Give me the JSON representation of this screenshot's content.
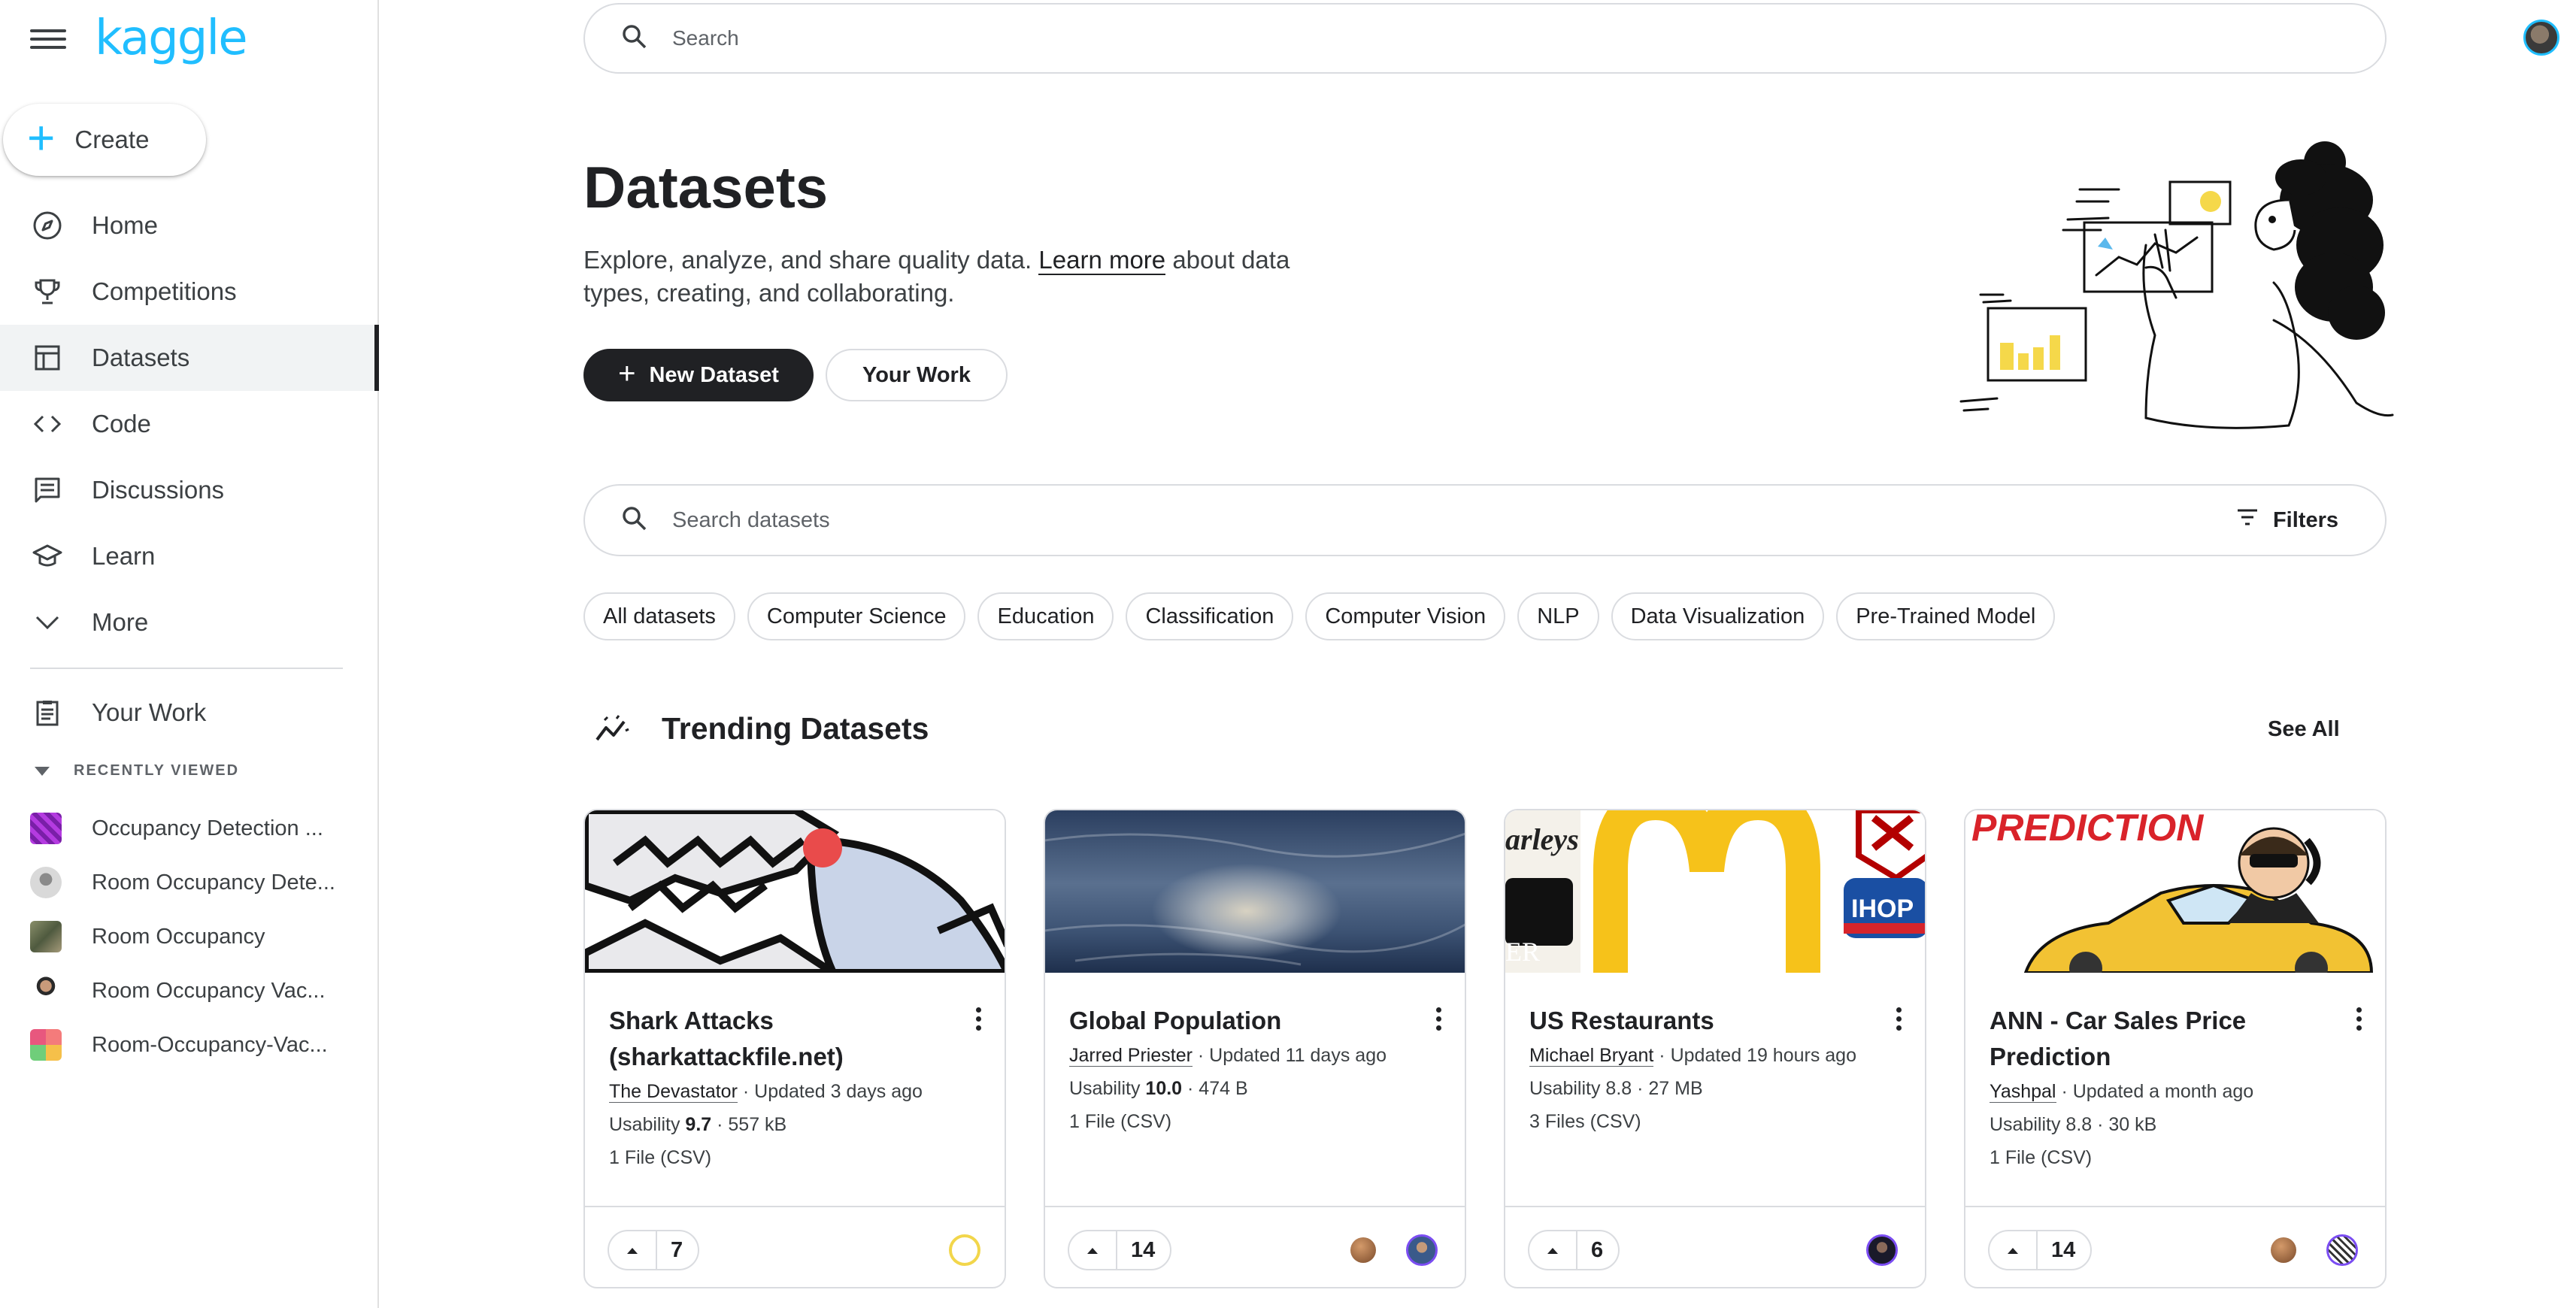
{
  "brand": {
    "logo_text": "kaggle"
  },
  "sidebar": {
    "create_label": "Create",
    "nav": [
      {
        "label": "Home",
        "icon": "compass-icon"
      },
      {
        "label": "Competitions",
        "icon": "trophy-icon"
      },
      {
        "label": "Datasets",
        "icon": "table-icon",
        "active": true
      },
      {
        "label": "Code",
        "icon": "code-icon"
      },
      {
        "label": "Discussions",
        "icon": "comments-icon"
      },
      {
        "label": "Learn",
        "icon": "school-icon"
      },
      {
        "label": "More",
        "icon": "chevron-down-icon"
      }
    ],
    "your_work_label": "Your Work",
    "recently_viewed_header": "RECENTLY VIEWED",
    "recently_viewed": [
      {
        "label": "Occupancy Detection ..."
      },
      {
        "label": "Room Occupancy Dete..."
      },
      {
        "label": "Room Occupancy"
      },
      {
        "label": "Room Occupancy Vac..."
      },
      {
        "label": "Room-Occupancy-Vac..."
      }
    ]
  },
  "top_search": {
    "placeholder": "Search"
  },
  "header": {
    "title": "Datasets",
    "desc_before": "Explore, analyze, and share quality data. ",
    "learn_more": "Learn more",
    "desc_after": " about data types, creating, and collaborating.",
    "new_dataset_label": "New Dataset",
    "your_work_label": "Your Work"
  },
  "dataset_search": {
    "placeholder": "Search datasets",
    "filters_label": "Filters"
  },
  "chips": [
    "All datasets",
    "Computer Science",
    "Education",
    "Classification",
    "Computer Vision",
    "NLP",
    "Data Visualization",
    "Pre-Trained Model"
  ],
  "trending": {
    "title": "Trending Datasets",
    "see_all": "See All",
    "cards": [
      {
        "title": "Shark Attacks (sharkattackfile.net)",
        "author": "The Devastator",
        "updated": " · Updated 3 days ago",
        "usability_label": "Usability ",
        "usability": "9.7",
        "size": " · 557 kB",
        "files": "1 File (CSV)",
        "votes": "7"
      },
      {
        "title": "Global Population",
        "author": "Jarred Priester",
        "updated": " · Updated 11 days ago",
        "usability_label": "Usability ",
        "usability": "10.0",
        "size": " · 474 B",
        "files": "1 File (CSV)",
        "votes": "14"
      },
      {
        "title": "US Restaurants",
        "author": "Michael Bryant",
        "updated": " · Updated 19 hours ago",
        "usability_label": "Usability 8.8",
        "usability": "",
        "size": " · 27 MB",
        "files": "3 Files (CSV)",
        "votes": "6"
      },
      {
        "title": "ANN - Car Sales Price Prediction",
        "author": "Yashpal",
        "updated": " · Updated a month ago",
        "usability_label": "Usability 8.8",
        "usability": "",
        "size": " · 30 kB",
        "files": "1 File (CSV)",
        "votes": "14"
      }
    ],
    "card_image_texts": {
      "ann_banner": "PREDICTION",
      "restaurant_sign_1": "arleys",
      "restaurant_sign_2": "IHOP",
      "restaurant_sign_3": "ER"
    }
  },
  "colors": {
    "brand": "#20beff",
    "primary_button": "#202124",
    "border": "#dadce0"
  }
}
